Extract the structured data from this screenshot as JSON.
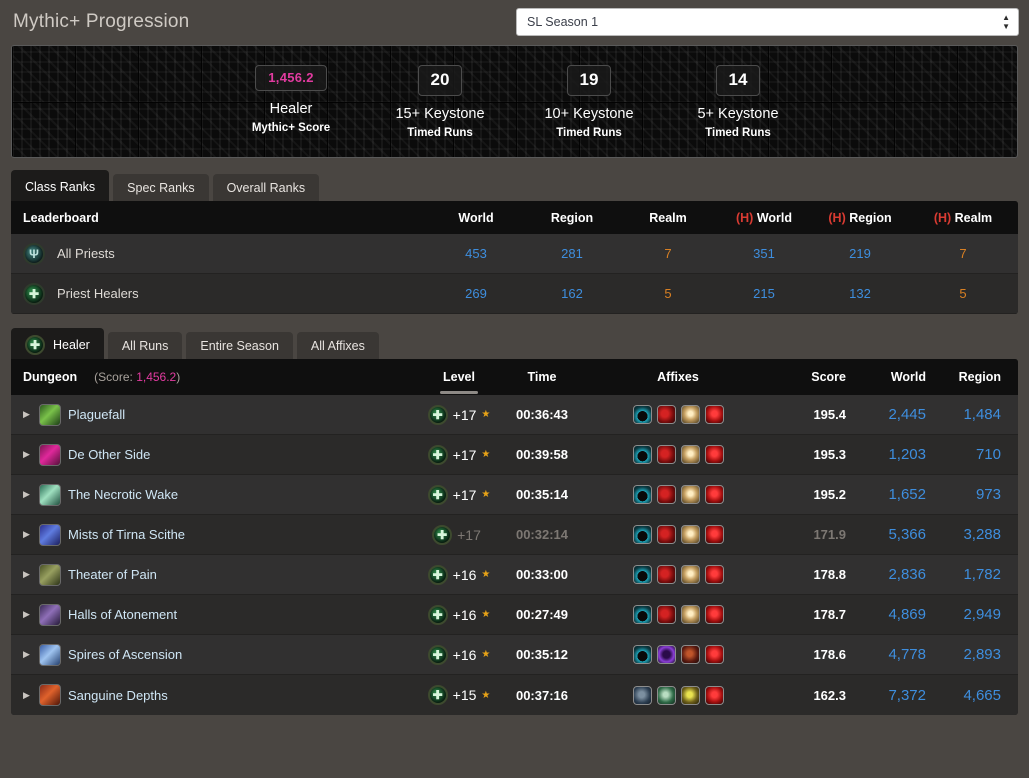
{
  "header": {
    "title": "Mythic+ Progression",
    "season_select": {
      "value": "SL Season 1",
      "spinner_up": "▲",
      "spinner_down": "▼"
    }
  },
  "stats": [
    {
      "value": "1,456.2",
      "label": "Healer",
      "sub": "Mythic+ Score",
      "accent": "#e23ba0"
    },
    {
      "value": "20",
      "label": "15+ Keystone",
      "sub": "Timed Runs",
      "accent": "#ffffff"
    },
    {
      "value": "19",
      "label": "10+ Keystone",
      "sub": "Timed Runs",
      "accent": "#ffffff"
    },
    {
      "value": "14",
      "label": "5+ Keystone",
      "sub": "Timed Runs",
      "accent": "#ffffff"
    }
  ],
  "rank_tabs": [
    {
      "label": "Class Ranks",
      "active": true
    },
    {
      "label": "Spec Ranks",
      "active": false
    },
    {
      "label": "Overall Ranks",
      "active": false
    }
  ],
  "leaderboard": {
    "title": "Leaderboard",
    "columns": [
      "World",
      "Region",
      "Realm",
      "World",
      "Region",
      "Realm"
    ],
    "horde_prefix": "(H)",
    "rows": [
      {
        "icon": "priest-class-icon",
        "glyph": "Ψ",
        "name": "All Priests",
        "world": "453",
        "region": "281",
        "realm": "7",
        "h_world": "351",
        "h_region": "219",
        "h_realm": "7"
      },
      {
        "icon": "priest-healer-icon",
        "glyph": "✚",
        "name": "Priest Healers",
        "world": "269",
        "region": "162",
        "realm": "5",
        "h_world": "215",
        "h_region": "132",
        "h_realm": "5"
      }
    ]
  },
  "run_tabs": [
    {
      "label": "Healer",
      "active": true,
      "icon": "healer-spec-icon"
    },
    {
      "label": "All Runs",
      "active": false,
      "icon": ""
    },
    {
      "label": "Entire Season",
      "active": false,
      "icon": ""
    },
    {
      "label": "All Affixes",
      "active": false,
      "icon": ""
    }
  ],
  "runs": {
    "col_dungeon": "Dungeon",
    "score_note_prefix": "(Score: ",
    "score_note_value": "1,456.2",
    "score_note_suffix": ")",
    "columns": {
      "level": "Level",
      "time": "Time",
      "affixes": "Affixes",
      "score": "Score",
      "world": "World",
      "region": "Region"
    },
    "sorted_column": "Level",
    "rows": [
      {
        "caret": "▶",
        "dungeon": "Plaguefall",
        "icon_color": "linear-gradient(135deg,#2c5a1e,#7ac24a 45%,#1d3d17)",
        "spec": "healer-spec-icon",
        "level": "+17",
        "star": "★",
        "time": "00:36:43",
        "timed": true,
        "affixes": [
          "tyrannical",
          "bursting",
          "explosive",
          "prideful"
        ],
        "score": "195.4",
        "world": "2,445",
        "region": "1,484"
      },
      {
        "caret": "▶",
        "dungeon": "De Other Side",
        "icon_color": "linear-gradient(135deg,#7a1550,#e0289b 45%,#55103a)",
        "spec": "healer-spec-icon",
        "level": "+17",
        "star": "★",
        "time": "00:39:58",
        "timed": true,
        "affixes": [
          "tyrannical",
          "bursting",
          "explosive",
          "prideful"
        ],
        "score": "195.3",
        "world": "1,203",
        "region": "710"
      },
      {
        "caret": "▶",
        "dungeon": "The Necrotic Wake",
        "icon_color": "linear-gradient(135deg,#2a6f56,#9fe0c0 45%,#20503f)",
        "spec": "healer-spec-icon",
        "level": "+17",
        "star": "★",
        "time": "00:35:14",
        "timed": true,
        "affixes": [
          "tyrannical",
          "bursting",
          "explosive",
          "prideful"
        ],
        "score": "195.2",
        "world": "1,652",
        "region": "973"
      },
      {
        "caret": "▶",
        "dungeon": "Mists of Tirna Scithe",
        "icon_color": "linear-gradient(135deg,#2b2f8e,#5f7ce0 45%,#1b1f5e)",
        "spec": "healer-spec-icon",
        "level": "+17",
        "star": "",
        "time": "00:32:14",
        "timed": false,
        "affixes": [
          "tyrannical",
          "bursting",
          "explosive",
          "prideful"
        ],
        "score": "171.9",
        "world": "5,366",
        "region": "3,288"
      },
      {
        "caret": "▶",
        "dungeon": "Theater of Pain",
        "icon_color": "linear-gradient(135deg,#4a5225,#98a060 45%,#2d3318)",
        "spec": "healer-spec-icon",
        "level": "+16",
        "star": "★",
        "time": "00:33:00",
        "timed": true,
        "affixes": [
          "tyrannical",
          "bursting",
          "explosive",
          "prideful"
        ],
        "score": "178.8",
        "world": "2,836",
        "region": "1,782"
      },
      {
        "caret": "▶",
        "dungeon": "Halls of Atonement",
        "icon_color": "linear-gradient(135deg,#3a2a55,#8f6fb8 45%,#251a38)",
        "spec": "healer-spec-icon",
        "level": "+16",
        "star": "★",
        "time": "00:27:49",
        "timed": true,
        "affixes": [
          "tyrannical",
          "bursting",
          "explosive",
          "prideful"
        ],
        "score": "178.7",
        "world": "4,869",
        "region": "2,949"
      },
      {
        "caret": "▶",
        "dungeon": "Spires of Ascension",
        "icon_color": "linear-gradient(135deg,#3a5fa8,#9fc4f0 45%,#24406f)",
        "spec": "healer-spec-icon",
        "level": "+16",
        "star": "★",
        "time": "00:35:12",
        "timed": true,
        "affixes": [
          "tyrannical",
          "volcanic",
          "necrotic",
          "prideful"
        ],
        "score": "178.6",
        "world": "4,778",
        "region": "2,893"
      },
      {
        "caret": "▶",
        "dungeon": "Sanguine Depths",
        "icon_color": "linear-gradient(135deg,#8a2a18,#e0622c 45%,#4d1508)",
        "spec": "healer-spec-icon",
        "level": "+15",
        "star": "★",
        "time": "00:37:16",
        "timed": true,
        "affixes": [
          "fortified",
          "raging",
          "spiteful",
          "prideful"
        ],
        "score": "162.3",
        "world": "7,372",
        "region": "4,665"
      }
    ]
  },
  "affix_art": {
    "tyrannical": "radial-gradient(circle at 50% 60%, #0a0a0a 38%, #1fa8bd 39%, #0c3e46 70%, #051a1f)",
    "bursting": "radial-gradient(circle at 40% 45%, #d42222 25%, #7a0d0d 60%, #240404)",
    "explosive": "radial-gradient(circle at 50% 45%, #ffeec2 18%, #c6a062 48%, #4a3a1d)",
    "prideful": "radial-gradient(circle at 50% 45%, #ff3b3b 22%, #a81010 58%, #2c0303)",
    "volcanic": "radial-gradient(circle at 50% 50%, #2b0b4a 30%, #8b3fd6 62%, #1a0530)",
    "necrotic": "radial-gradient(circle at 45% 45%, #c0552a 20%, #5a1a10 60%, #1c0806)",
    "fortified": "radial-gradient(circle at 45% 45%, #7c8fa0 22%, #2d3f52 62%, #101a26)",
    "raging": "radial-gradient(circle at 45% 45%, #b9ddc2 18%, #2f6b48 58%, #10291c)",
    "spiteful": "radial-gradient(circle at 45% 45%, #e9e24f 20%, #6d5f1a 58%, #241f06)"
  }
}
